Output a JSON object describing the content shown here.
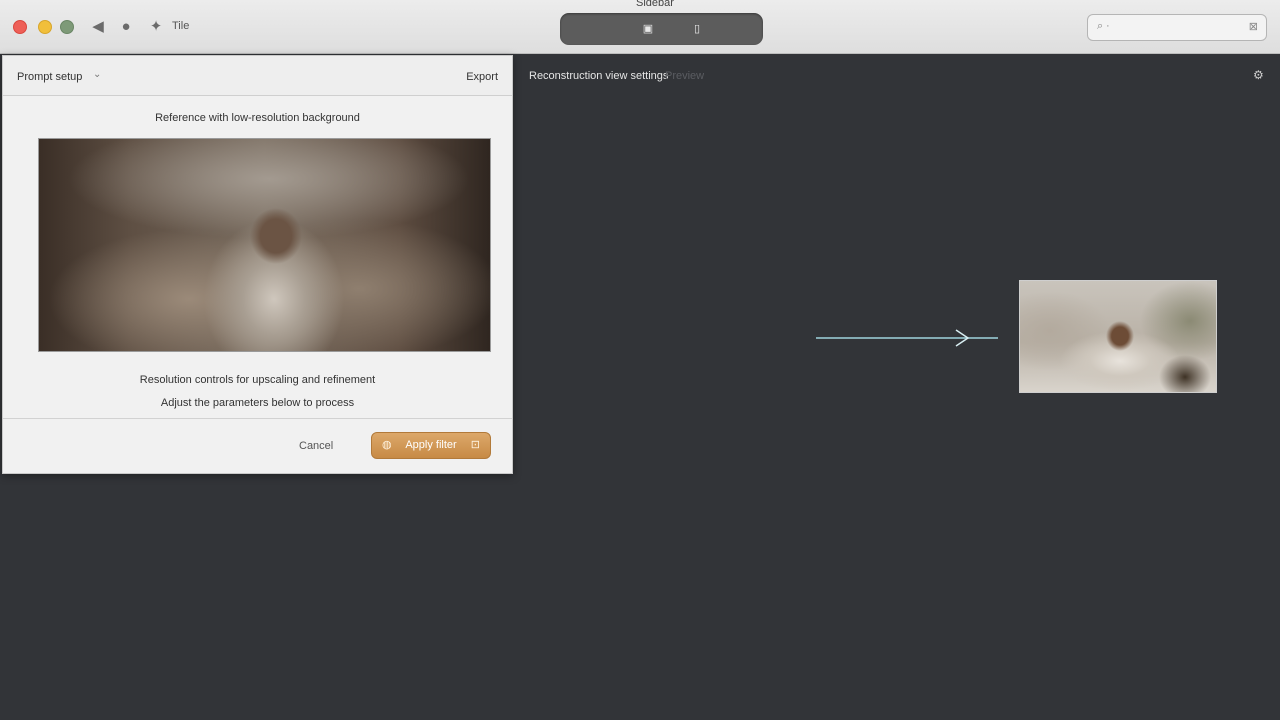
{
  "window": {
    "title": "Sidebar"
  },
  "toolbar": {
    "back_icon": "back-arrow-icon",
    "info_icon": "info-icon",
    "tool_icon": "tool-icon",
    "tool_label": "Tile",
    "segment_left_glyph": "▣",
    "segment_right_glyph": "▯"
  },
  "search": {
    "placeholder": "",
    "value": ""
  },
  "panel": {
    "title": "Prompt setup",
    "action": "Export",
    "caption_top": "Reference with low-resolution background",
    "caption_line1": "Resolution controls for upscaling and refinement",
    "caption_line2": "Adjust the parameters below to process",
    "secondary_label": "Cancel",
    "primary_label": "Apply filter"
  },
  "canvas": {
    "header_text": "Reconstruction view settings",
    "header_dim": "Preview"
  },
  "colors": {
    "canvas_bg": "#323438",
    "accent": "#c78a45",
    "close": "#ee5f57",
    "minimize": "#f1bf3b",
    "maximize": "#7e9a78"
  }
}
